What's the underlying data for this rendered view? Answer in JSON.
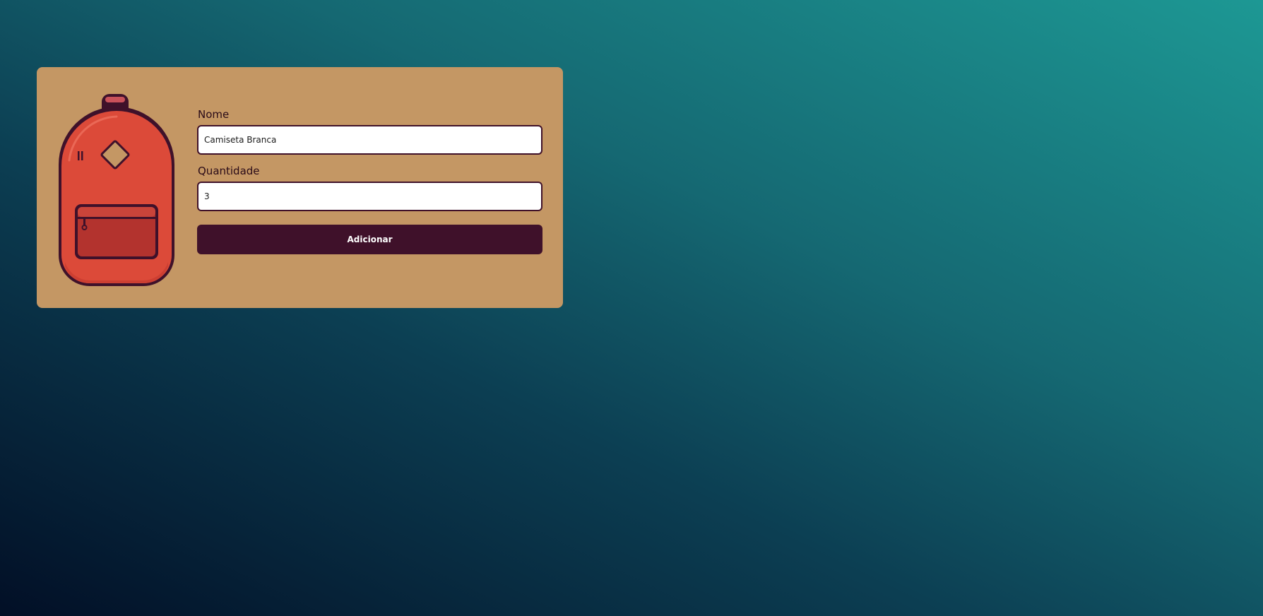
{
  "form": {
    "name_label": "Nome",
    "name_value": "Camiseta Branca",
    "quantity_label": "Quantidade",
    "quantity_value": "3",
    "submit_label": "Adicionar"
  },
  "illustration": {
    "icon": "backpack-icon",
    "colors": {
      "body": "#dc4a39",
      "pocket": "#b3332e",
      "outline": "#3f112a",
      "patch": "#c49764"
    }
  },
  "colors": {
    "card_background": "#c49764",
    "accent": "#3f112a",
    "page_gradient": [
      "#020f26",
      "#0c3f53",
      "#156872",
      "#1d9894"
    ]
  }
}
